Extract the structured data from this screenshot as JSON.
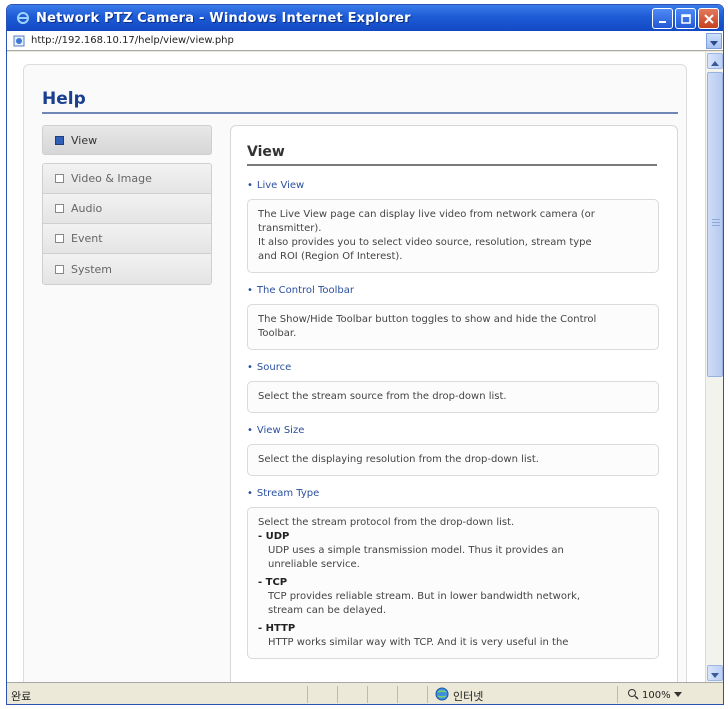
{
  "window": {
    "title": "Network PTZ Camera - Windows Internet Explorer"
  },
  "address": {
    "url": "http://192.168.10.17/help/view/view.php"
  },
  "help": {
    "title": "Help"
  },
  "sidebar": {
    "items": [
      {
        "label": "View"
      },
      {
        "label": "Video & Image"
      },
      {
        "label": "Audio"
      },
      {
        "label": "Event"
      },
      {
        "label": "System"
      }
    ]
  },
  "main": {
    "title": "View",
    "sections": [
      {
        "heading": "Live View",
        "lines": [
          "The Live View page can display live video from network camera (or",
          "transmitter).",
          "It also provides you to select video source, resolution, stream type",
          "and ROI (Region Of Interest)."
        ]
      },
      {
        "heading": "The Control Toolbar",
        "lines": [
          "The Show/Hide Toolbar button toggles to show and hide the Control",
          "Toolbar."
        ]
      },
      {
        "heading": "Source",
        "lines": [
          "Select the stream source from the drop-down list."
        ]
      },
      {
        "heading": "View Size",
        "lines": [
          "Select the displaying resolution from the drop-down list."
        ]
      },
      {
        "heading": "Stream Type",
        "intro": "Select the stream protocol from the drop-down list.",
        "subitems": [
          {
            "name": "- UDP",
            "lines": [
              "UDP uses a simple transmission model. Thus it provides an",
              "unreliable service."
            ]
          },
          {
            "name": "- TCP",
            "lines": [
              "TCP provides reliable stream. But in lower bandwidth network,",
              "stream can be delayed."
            ]
          },
          {
            "name": "- HTTP",
            "lines": [
              "HTTP works similar way with TCP. And it is very useful in the"
            ]
          }
        ]
      }
    ]
  },
  "statusbar": {
    "left": "완료",
    "zone": "인터넷",
    "zoom": "100%"
  },
  "colors": {
    "titlebar": "#1d5cd6",
    "accent": "#2a4fa0",
    "help_title": "#1b3f8f"
  },
  "icons": [
    "ie-logo-icon",
    "minimize-icon",
    "maximize-icon",
    "close-icon",
    "page-icon",
    "dropdown-arrow-icon",
    "scroll-up-icon",
    "scroll-down-icon",
    "globe-icon",
    "zoom-icon"
  ]
}
